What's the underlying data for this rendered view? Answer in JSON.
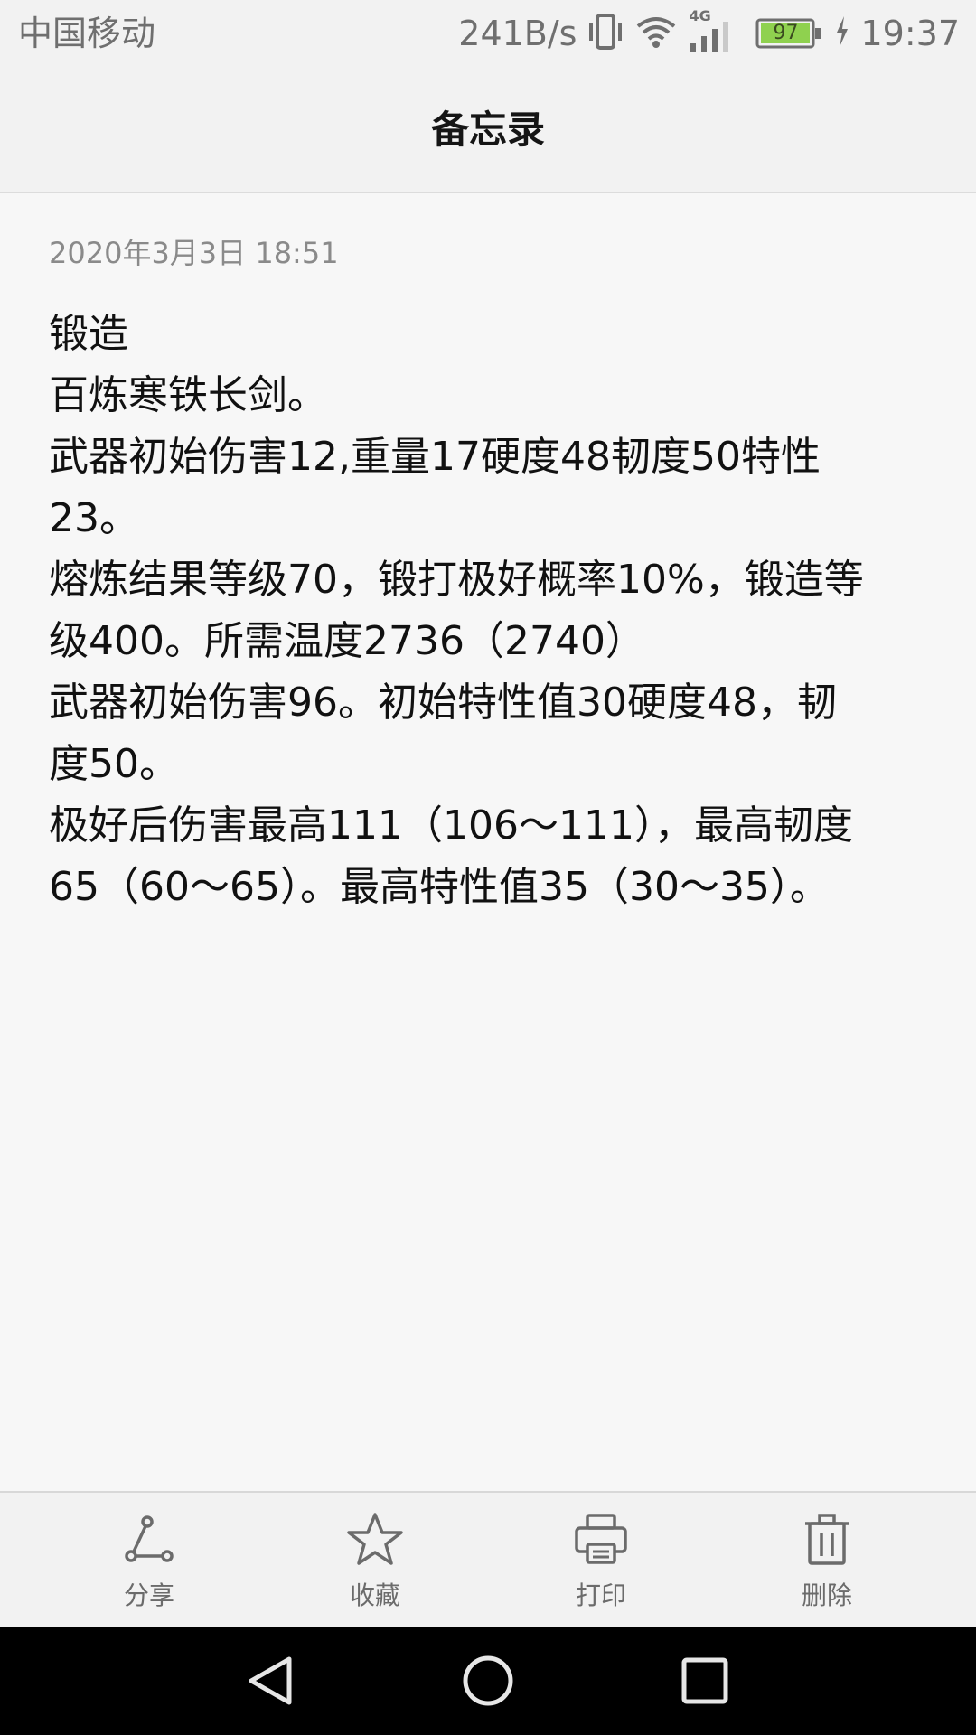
{
  "status_bar": {
    "carrier": "中国移动",
    "network_speed": "241B/s",
    "network_type": "4G",
    "battery": "97",
    "time": "19:37"
  },
  "header": {
    "title": "备忘录"
  },
  "note": {
    "date": "2020年3月3日 18:51",
    "lines": [
      "锻造",
      "百炼寒铁长剑。",
      "武器初始伤害12,重量17硬度48韧度50特性",
      "23。",
      "熔炼结果等级70，锻打极好概率10%，锻造等",
      "级400。所需温度2736（2740）",
      "武器初始伤害96。初始特性值30硬度48，韧",
      "度50。",
      "极好后伤害最高111（106～111），最高韧度",
      "65（60～65）。最高特性值35（30～35）。"
    ]
  },
  "toolbar": {
    "share_label": "分享",
    "favorite_label": "收藏",
    "print_label": "打印",
    "delete_label": "删除"
  },
  "icons": {
    "share": "share-icon",
    "favorite": "star-icon",
    "print": "printer-icon",
    "delete": "trash-icon",
    "back": "back-triangle-icon",
    "home": "home-circle-icon",
    "recents": "recents-square-icon"
  },
  "colors": {
    "battery_fill": "#8fd14f",
    "icon_gray": "#6b6b6b"
  }
}
